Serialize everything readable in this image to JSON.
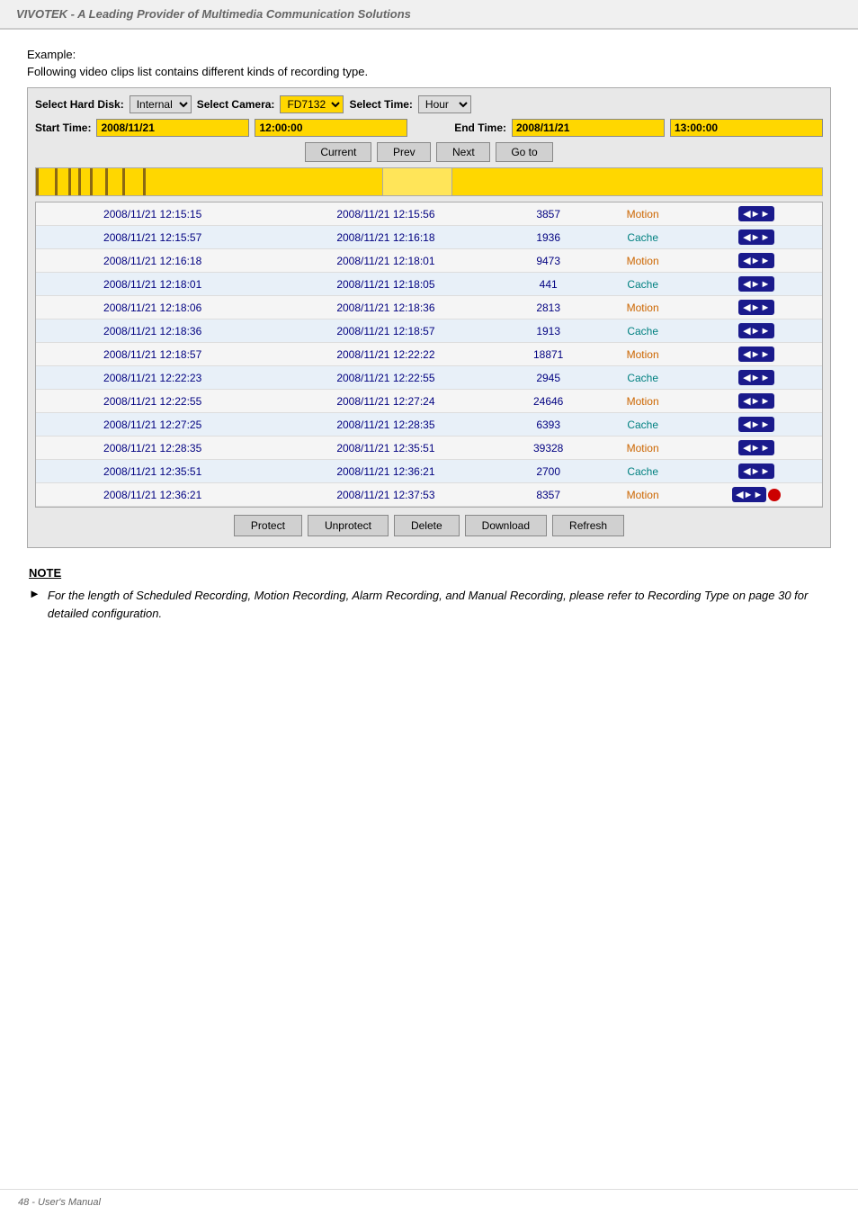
{
  "header": {
    "title": "VIVOTEK - A Leading Provider of Multimedia Communication Solutions"
  },
  "example": {
    "label": "Example:",
    "desc": "Following video clips list contains different kinds of recording type."
  },
  "controls": {
    "hard_disk_label": "Select Hard Disk:",
    "hard_disk_value": "Internal",
    "camera_label": "Select Camera:",
    "camera_value": "FD7132",
    "time_label": "Select Time:",
    "time_value": "Hour",
    "start_time_label": "Start Time:",
    "start_date": "2008/11/21",
    "start_time": "12:00:00",
    "end_time_label": "End Time:",
    "end_date": "2008/11/21",
    "end_time": "13:00:00"
  },
  "nav_buttons": {
    "current": "Current",
    "prev": "Prev",
    "next": "Next",
    "goto": "Go to"
  },
  "table": {
    "rows": [
      {
        "start": "2008/11/21 12:15:15",
        "end": "2008/11/21 12:15:56",
        "size": "3857",
        "type": "Motion",
        "type_class": "type-motion"
      },
      {
        "start": "2008/11/21 12:15:57",
        "end": "2008/11/21 12:16:18",
        "size": "1936",
        "type": "Cache",
        "type_class": "type-cache"
      },
      {
        "start": "2008/11/21 12:16:18",
        "end": "2008/11/21 12:18:01",
        "size": "9473",
        "type": "Motion",
        "type_class": "type-motion"
      },
      {
        "start": "2008/11/21 12:18:01",
        "end": "2008/11/21 12:18:05",
        "size": "441",
        "type": "Cache",
        "type_class": "type-cache"
      },
      {
        "start": "2008/11/21 12:18:06",
        "end": "2008/11/21 12:18:36",
        "size": "2813",
        "type": "Motion",
        "type_class": "type-motion"
      },
      {
        "start": "2008/11/21 12:18:36",
        "end": "2008/11/21 12:18:57",
        "size": "1913",
        "type": "Cache",
        "type_class": "type-cache"
      },
      {
        "start": "2008/11/21 12:18:57",
        "end": "2008/11/21 12:22:22",
        "size": "18871",
        "type": "Motion",
        "type_class": "type-motion"
      },
      {
        "start": "2008/11/21 12:22:23",
        "end": "2008/11/21 12:22:55",
        "size": "2945",
        "type": "Cache",
        "type_class": "type-cache"
      },
      {
        "start": "2008/11/21 12:22:55",
        "end": "2008/11/21 12:27:24",
        "size": "24646",
        "type": "Motion",
        "type_class": "type-motion"
      },
      {
        "start": "2008/11/21 12:27:25",
        "end": "2008/11/21 12:28:35",
        "size": "6393",
        "type": "Cache",
        "type_class": "type-cache"
      },
      {
        "start": "2008/11/21 12:28:35",
        "end": "2008/11/21 12:35:51",
        "size": "39328",
        "type": "Motion",
        "type_class": "type-motion"
      },
      {
        "start": "2008/11/21 12:35:51",
        "end": "2008/11/21 12:36:21",
        "size": "2700",
        "type": "Cache",
        "type_class": "type-cache"
      },
      {
        "start": "2008/11/21 12:36:21",
        "end": "2008/11/21 12:37:53",
        "size": "8357",
        "type": "Motion",
        "type_class": "type-motion"
      }
    ]
  },
  "bottom_buttons": {
    "protect": "Protect",
    "unprotect": "Unprotect",
    "delete": "Delete",
    "download": "Download",
    "refresh": "Refresh"
  },
  "note": {
    "title": "NOTE",
    "text": "For the length of Scheduled Recording, Motion Recording, Alarm Recording, and Manual Recording, please refer to Recording Type on page 30 for detailed configuration."
  },
  "footer": {
    "text": "48 - User's Manual"
  }
}
